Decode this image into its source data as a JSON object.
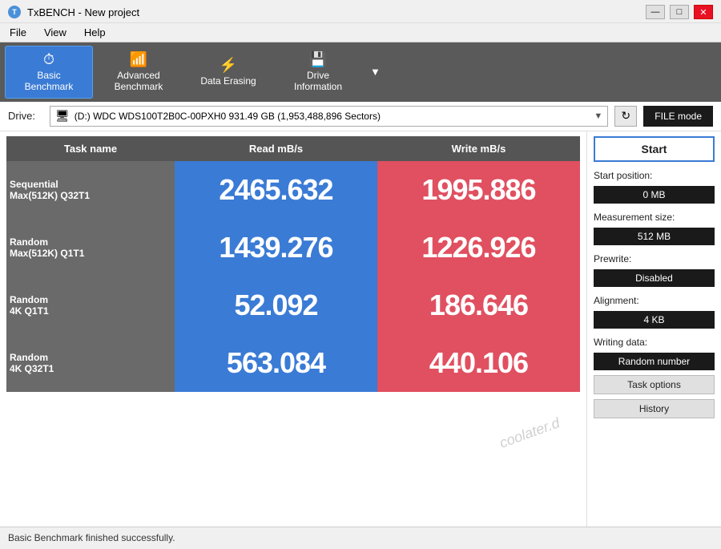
{
  "window": {
    "title": "TxBENCH - New project",
    "icon": "T"
  },
  "title_controls": {
    "minimize": "—",
    "maximize": "□",
    "close": "✕"
  },
  "menu": {
    "items": [
      "File",
      "View",
      "Help"
    ]
  },
  "toolbar": {
    "buttons": [
      {
        "id": "basic",
        "icon": "⏱",
        "label": "Basic\nBenchmark",
        "active": true
      },
      {
        "id": "advanced",
        "icon": "📊",
        "label": "Advanced\nBenchmark",
        "active": false
      },
      {
        "id": "erasing",
        "icon": "🗑",
        "label": "Data Erasing",
        "active": false
      },
      {
        "id": "drive_info",
        "icon": "💾",
        "label": "Drive\nInformation",
        "active": false
      }
    ],
    "more": "▼"
  },
  "drive": {
    "label": "Drive:",
    "value": "(D:) WDC WDS100T2B0C-00PXH0  931.49 GB (1,953,488,896 Sectors)",
    "placeholder": "Select drive",
    "refresh_icon": "↻",
    "file_mode_label": "FILE mode"
  },
  "table": {
    "headers": [
      "Task name",
      "Read mB/s",
      "Write mB/s"
    ],
    "rows": [
      {
        "task": "Sequential\nMax(512K) Q32T1",
        "read": "2465.632",
        "write": "1995.886"
      },
      {
        "task": "Random\nMax(512K) Q1T1",
        "read": "1439.276",
        "write": "1226.926"
      },
      {
        "task": "Random\n4K Q1T1",
        "read": "52.092",
        "write": "186.646"
      },
      {
        "task": "Random\n4K Q32T1",
        "read": "563.084",
        "write": "440.106"
      }
    ]
  },
  "right_panel": {
    "start_label": "Start",
    "start_position_label": "Start position:",
    "start_position_value": "0 MB",
    "measurement_size_label": "Measurement size:",
    "measurement_size_value": "512 MB",
    "prewrite_label": "Prewrite:",
    "prewrite_value": "Disabled",
    "alignment_label": "Alignment:",
    "alignment_value": "4 KB",
    "writing_data_label": "Writing data:",
    "writing_data_value": "Random number",
    "task_options_label": "Task options",
    "history_label": "History"
  },
  "status_bar": {
    "message": "Basic Benchmark finished successfully."
  },
  "watermark": "coolater.d"
}
